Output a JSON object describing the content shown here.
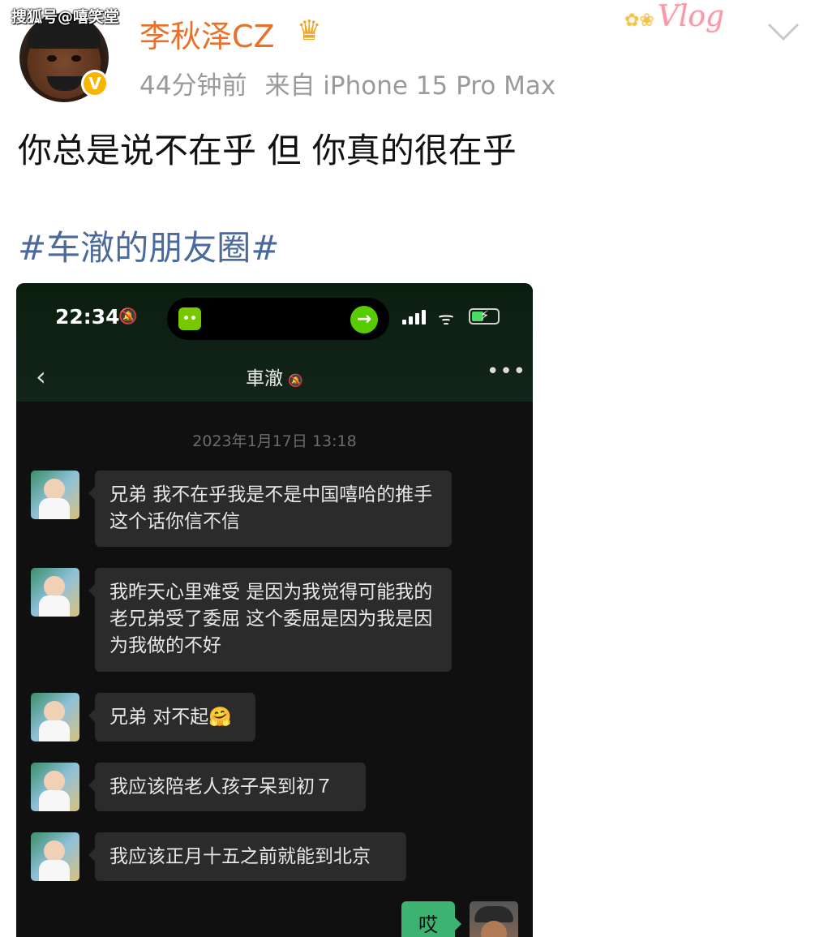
{
  "watermark": "搜狐号@嘻笑堂",
  "post": {
    "username": "李秋泽CZ",
    "crown_icon": "crown-icon",
    "verified_mark": "V",
    "time": "44分钟前",
    "source": "来自 iPhone 15 Pro Max",
    "sticker_text": "Vlog",
    "text": "你总是说不在乎 但 你真的很在乎",
    "hashtag": "#车澈的朋友圈#"
  },
  "phone": {
    "status_time": "22:34",
    "app_badge": "••",
    "chat_title": "車澈",
    "timestamp": "2023年1月17日 13:18",
    "messages": [
      {
        "text": "兄弟 我不在乎我是不是中国嘻哈的推手 这个话你信不信"
      },
      {
        "text": "我昨天心里难受 是因为我觉得可能我的老兄弟受了委屈 这个委屈是因为我是因为我做的不好"
      },
      {
        "text": "兄弟 对不起🤗"
      },
      {
        "text": "我应该陪老人孩子呆到初７"
      },
      {
        "text": "我应该正月十五之前就能到北京"
      }
    ],
    "my_message": "哎"
  }
}
